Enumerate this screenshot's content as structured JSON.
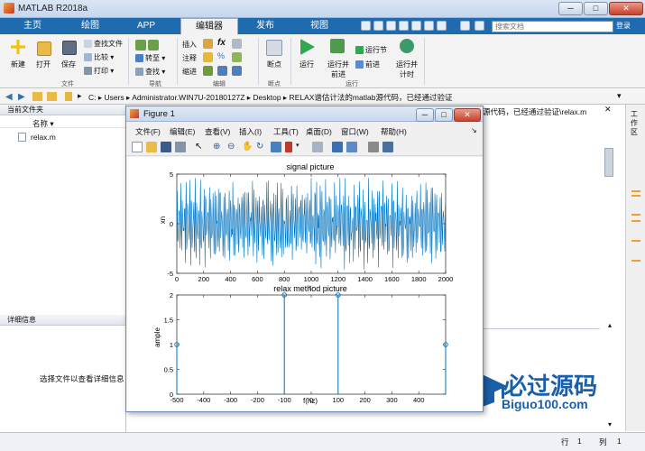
{
  "window": {
    "title": "MATLAB R2018a",
    "buttons": [
      "─",
      "□",
      "✕"
    ]
  },
  "tabs": [
    {
      "label": "主页",
      "active": false
    },
    {
      "label": "绘图",
      "active": false
    },
    {
      "label": "APP",
      "active": false
    },
    {
      "label": "编辑器",
      "active": true
    },
    {
      "label": "发布",
      "active": false
    },
    {
      "label": "视图",
      "active": false
    }
  ],
  "search": {
    "placeholder": "搜索文档"
  },
  "login": "登录",
  "ribbon": {
    "file": {
      "new": "新建",
      "open": "打开",
      "save": "保存",
      "find_files": "查找文件",
      "compare": "比较",
      "print": "打印",
      "group": "文件"
    },
    "nav": {
      "goto": "转至",
      "find": "查找",
      "group": "导航"
    },
    "edit": {
      "insert": "插入",
      "comment": "注释",
      "indent": "缩进",
      "group": "编辑"
    },
    "breakpoints": {
      "label": "断点",
      "group": "断点"
    },
    "run": {
      "run": "运行",
      "run_advance_1": "运行并",
      "run_advance_2": "前进",
      "run_section": "运行节",
      "advance": "前进",
      "run_time_1": "运行并",
      "run_time_2": "计时",
      "group": "运行"
    }
  },
  "address": {
    "path": "C:  ▸  Users  ▸  Administrator.WIN7U-20180127Z  ▸  Desktop  ▸  RELAX谱估计法的matlab源代码，已经通过验证",
    "path_tail": "源代码，已经通过验证\\relax.m"
  },
  "current_folder": {
    "title": "当前文件夹",
    "column": "名称 ▾",
    "files": [
      "relax.m"
    ]
  },
  "details": {
    "title": "详细信息",
    "message": "选择文件以查看详细信息"
  },
  "workspace_strip": "工作区",
  "status": {
    "row_label": "行",
    "row": "1",
    "col_label": "列",
    "col": "1"
  },
  "figure": {
    "title": "Figure 1",
    "menu": [
      "文件(F)",
      "编辑(E)",
      "查看(V)",
      "插入(I)",
      "工具(T)",
      "桌面(D)",
      "窗口(W)",
      "帮助(H)"
    ]
  },
  "chart_data": [
    {
      "type": "line",
      "title": "signal picture",
      "xlabel": "t",
      "ylabel": "xn",
      "xlim": [
        0,
        2000
      ],
      "ylim": [
        -5,
        5
      ],
      "xticks": [
        0,
        200,
        400,
        600,
        800,
        1000,
        1200,
        1400,
        1600,
        1800,
        2000
      ],
      "yticks": [
        -5,
        0,
        5
      ],
      "color": "#0072BD",
      "series": [
        {
          "description": "noisy multi-tone signal oscillating approximately between -4.5 and 4.5 over 2000 samples"
        }
      ]
    },
    {
      "type": "stem",
      "title": "relax method picture",
      "xlabel": "f(hz)",
      "ylabel": "ample",
      "xlim": [
        -500,
        500
      ],
      "ylim": [
        0,
        2
      ],
      "xticks": [
        -500,
        -400,
        -300,
        -200,
        -100,
        0,
        100,
        200,
        300,
        400
      ],
      "yticks": [
        0,
        0.5,
        1,
        1.5,
        2
      ],
      "color": "#0072BD",
      "x": [
        -500,
        -100,
        100,
        500
      ],
      "y": [
        1,
        2,
        2,
        1
      ]
    }
  ],
  "watermark": {
    "brand": "必过源码",
    "url": "Biguo100.com"
  }
}
